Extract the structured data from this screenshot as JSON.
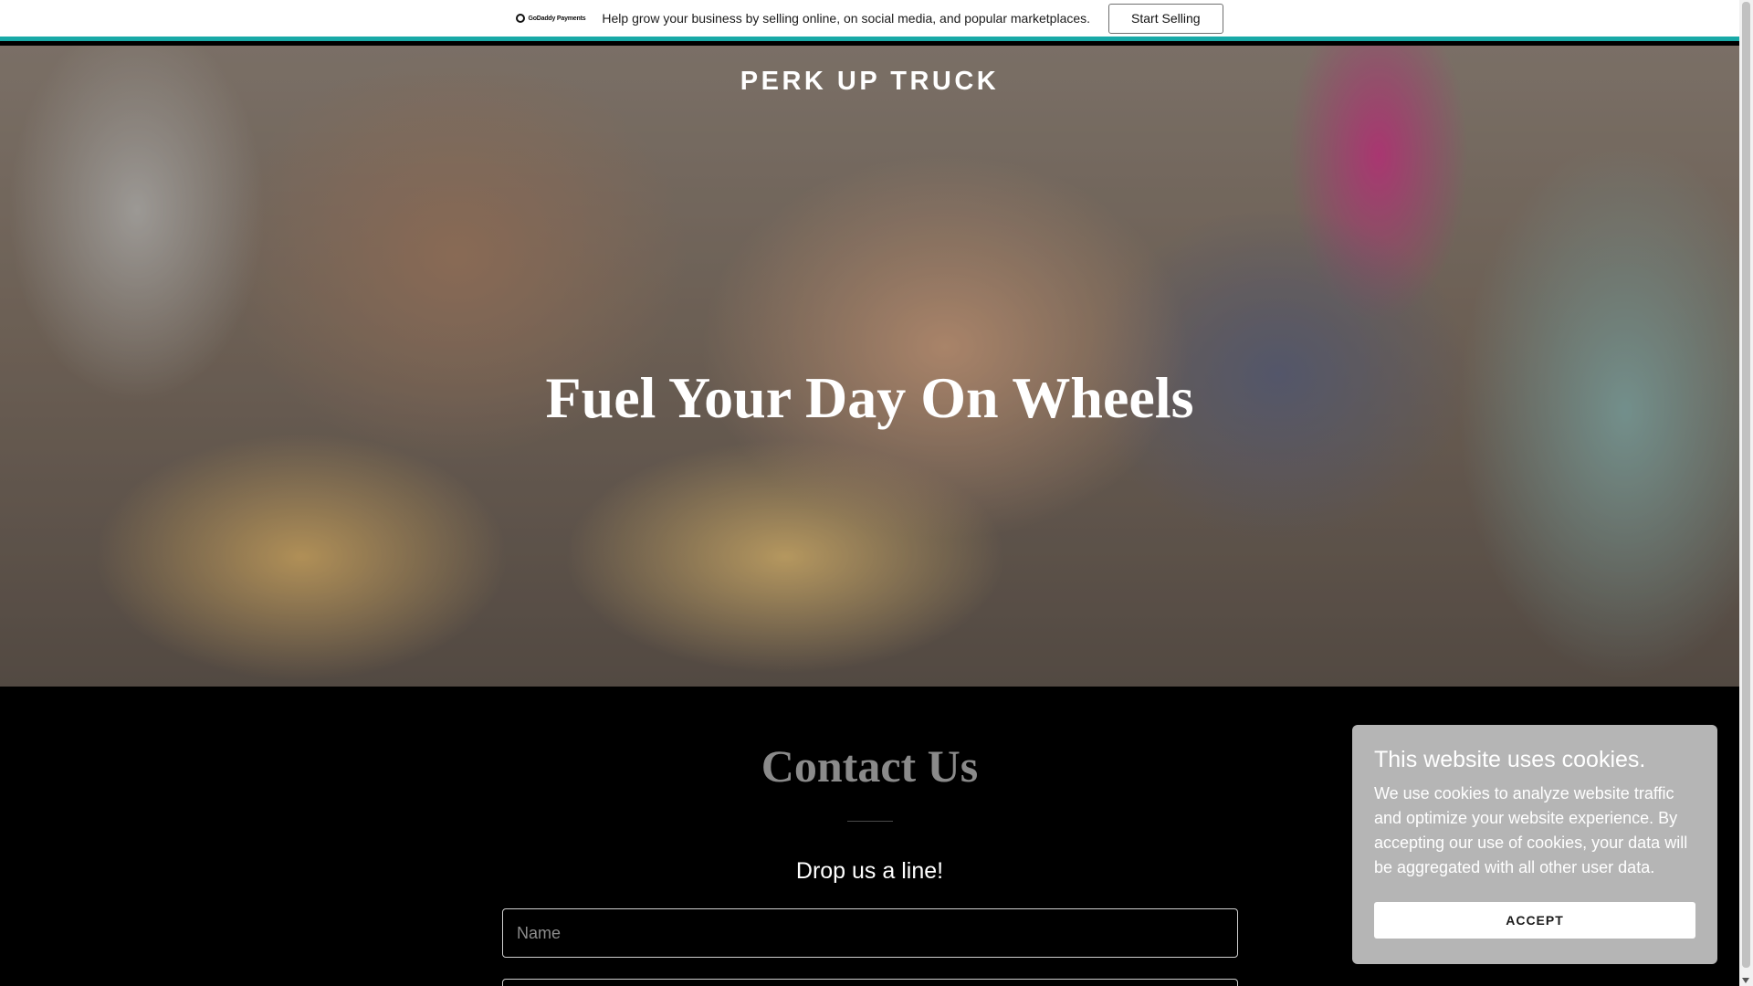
{
  "promo_bar": {
    "logo_text": "GoDaddy Payments",
    "message": "Help grow your business by selling online, on social media, and popular marketplaces.",
    "button_label": "Start Selling",
    "accent_color": "#18a9a7"
  },
  "hero": {
    "brand": "PERK UP TRUCK",
    "headline": "Fuel Your Day On Wheels"
  },
  "contact": {
    "title": "Contact Us",
    "subtitle": "Drop us a line!",
    "name_placeholder": "Name",
    "email_placeholder": ""
  },
  "cookie_banner": {
    "title": "This website uses cookies.",
    "body": "We use cookies to analyze website traffic and optimize your website experience. By accepting our use of cookies, your data will be aggregated with all other user data.",
    "accept_label": "ACCEPT"
  }
}
